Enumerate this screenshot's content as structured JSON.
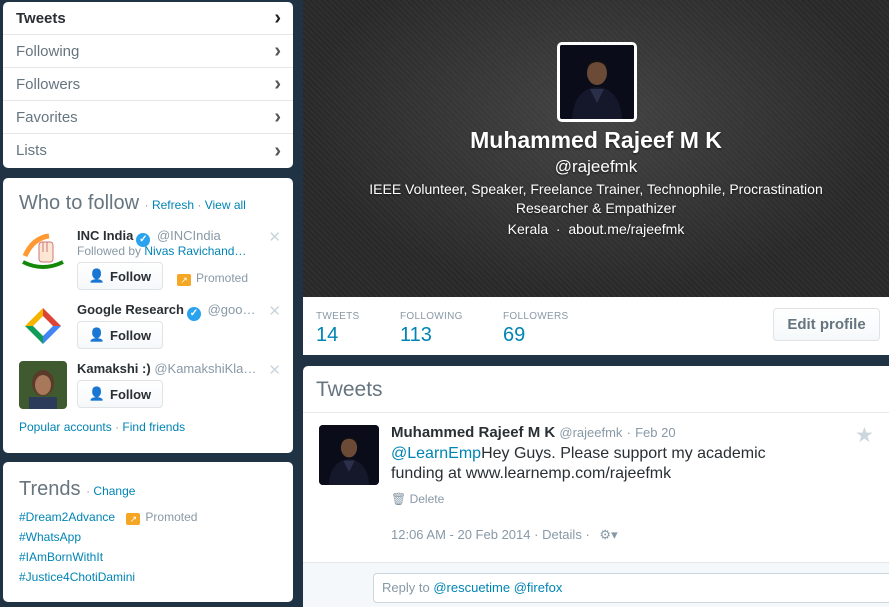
{
  "nav": {
    "items": [
      {
        "label": "Tweets"
      },
      {
        "label": "Following"
      },
      {
        "label": "Followers"
      },
      {
        "label": "Favorites"
      },
      {
        "label": "Lists"
      }
    ],
    "chevron": "›"
  },
  "who_to_follow": {
    "title": "Who to follow",
    "refresh": "Refresh",
    "view_all": "View all",
    "separator": "·",
    "follow_label": "Follow",
    "promoted_label": "Promoted",
    "suggestions": [
      {
        "name": "INC India",
        "handle": "@INCIndia",
        "followed_by_prefix": "Followed by",
        "followed_by": "Nivas Ravichand…"
      },
      {
        "name": "Google Research",
        "handle": "@goo…"
      },
      {
        "name": "Kamakshi :)",
        "handle": "@KamakshiKla…"
      }
    ],
    "footer_popular": "Popular accounts",
    "footer_find": "Find friends"
  },
  "trends": {
    "title": "Trends",
    "change": "Change",
    "items": [
      "#Dream2Advance",
      "#WhatsApp",
      "#IAmBornWithIt",
      "#Justice4ChotiDamini"
    ],
    "promoted_label": "Promoted"
  },
  "profile": {
    "name": "Muhammed Rajeef M K",
    "handle": "@rajeefmk",
    "bio": "IEEE Volunteer, Speaker, Freelance Trainer, Technophile, Procrastination Researcher & Empathizer",
    "location": "Kerala",
    "url": "about.me/rajeefmk",
    "dot": "·"
  },
  "stats": {
    "tweets_label": "TWEETS",
    "tweets": "14",
    "following_label": "FOLLOWING",
    "following": "113",
    "followers_label": "FOLLOWERS",
    "followers": "69",
    "edit_profile": "Edit profile"
  },
  "timeline": {
    "title": "Tweets",
    "tweet": {
      "name": "Muhammed Rajeef M K",
      "handle": "@rajeefmk",
      "date": "Feb 20",
      "mention": "@LearnEmp",
      "text": "Hey Guys. Please support my academic funding at www.learnemp.com/rajeefmk",
      "delete": "Delete",
      "timestamp": "12:06 AM - 20 Feb 2014",
      "details": "Details"
    },
    "reply_prefix": "Reply to",
    "reply_mentions": [
      "@rescuetime",
      "@firefox"
    ]
  },
  "colors": {
    "link": "#0084b4",
    "page_bg": "#1f3344",
    "verified": "#2aa3ef",
    "promoted": "#f5a623"
  },
  "icons": [
    "chevron-right-icon",
    "verified-icon",
    "close-icon",
    "add-user-icon",
    "promoted-icon",
    "star-icon",
    "trash-icon",
    "gear-icon"
  ]
}
